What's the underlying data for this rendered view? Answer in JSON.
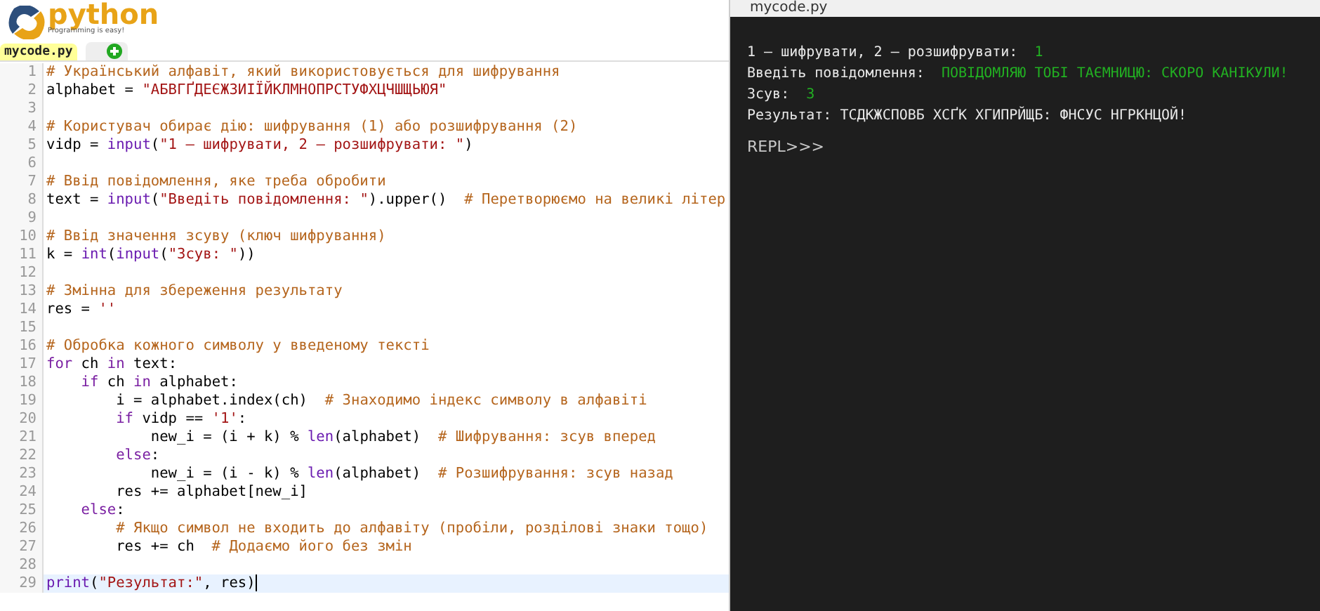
{
  "logo": {
    "name": "python",
    "tagline": "Programming is easy!"
  },
  "tabs": [
    {
      "label": "mycode.py",
      "selected": true
    }
  ],
  "code": [
    {
      "n": "1",
      "tokens": [
        {
          "t": "# Український алфавіт, який використовується для шифрування",
          "kind": "comment"
        }
      ]
    },
    {
      "n": "2",
      "tokens": [
        {
          "t": "alphabet = ",
          "kind": "plain"
        },
        {
          "t": "\"АБВГҐДЕЄЖЗИІЇЙКЛМНОПРСТУФХЦЧШЩЬЮЯ\"",
          "kind": "string"
        }
      ]
    },
    {
      "n": "3"
    },
    {
      "n": "4",
      "tokens": [
        {
          "t": "# Користувач обирає дію: шифрування (1) або розшифрування (2)",
          "kind": "comment"
        }
      ]
    },
    {
      "n": "5",
      "tokens": [
        {
          "t": "vidp = ",
          "kind": "plain"
        },
        {
          "t": "input",
          "kind": "builtin"
        },
        {
          "t": "(",
          "kind": "plain"
        },
        {
          "t": "\"1 — шифрувати, 2 — розшифрувати: \"",
          "kind": "string"
        },
        {
          "t": ")",
          "kind": "plain"
        }
      ]
    },
    {
      "n": "6"
    },
    {
      "n": "7",
      "tokens": [
        {
          "t": "# Ввід повідомлення, яке треба обробити",
          "kind": "comment"
        }
      ]
    },
    {
      "n": "8",
      "tokens": [
        {
          "t": "text = ",
          "kind": "plain"
        },
        {
          "t": "input",
          "kind": "builtin"
        },
        {
          "t": "(",
          "kind": "plain"
        },
        {
          "t": "\"Введіть повідомлення: \"",
          "kind": "string"
        },
        {
          "t": ").upper()  ",
          "kind": "plain"
        },
        {
          "t": "# Перетворюємо на великі літер",
          "kind": "comment"
        }
      ]
    },
    {
      "n": "9"
    },
    {
      "n": "10",
      "tokens": [
        {
          "t": "# Ввід значення зсуву (ключ шифрування)",
          "kind": "comment"
        }
      ]
    },
    {
      "n": "11",
      "tokens": [
        {
          "t": "k = ",
          "kind": "plain"
        },
        {
          "t": "int",
          "kind": "builtin"
        },
        {
          "t": "(",
          "kind": "plain"
        },
        {
          "t": "input",
          "kind": "builtin"
        },
        {
          "t": "(",
          "kind": "plain"
        },
        {
          "t": "\"Зсув: \"",
          "kind": "string"
        },
        {
          "t": "))",
          "kind": "plain"
        }
      ]
    },
    {
      "n": "12"
    },
    {
      "n": "13",
      "tokens": [
        {
          "t": "# Змінна для збереження результату",
          "kind": "comment"
        }
      ]
    },
    {
      "n": "14",
      "tokens": [
        {
          "t": "res = ",
          "kind": "plain"
        },
        {
          "t": "''",
          "kind": "string"
        }
      ]
    },
    {
      "n": "15"
    },
    {
      "n": "16",
      "tokens": [
        {
          "t": "# Обробка кожного символу у введеному тексті",
          "kind": "comment"
        }
      ]
    },
    {
      "n": "17",
      "tokens": [
        {
          "t": "for",
          "kind": "keyword"
        },
        {
          "t": " ch ",
          "kind": "plain"
        },
        {
          "t": "in",
          "kind": "keyword"
        },
        {
          "t": " text:",
          "kind": "plain"
        }
      ]
    },
    {
      "n": "18",
      "tokens": [
        {
          "t": "    if",
          "kind": "keyword"
        },
        {
          "t": " ch ",
          "kind": "plain"
        },
        {
          "t": "in",
          "kind": "keyword"
        },
        {
          "t": " alphabet:",
          "kind": "plain"
        }
      ]
    },
    {
      "n": "19",
      "tokens": [
        {
          "t": "        i = alphabet.index(ch)  ",
          "kind": "plain"
        },
        {
          "t": "# Знаходимо індекс символу в алфавіті",
          "kind": "comment"
        }
      ]
    },
    {
      "n": "20",
      "tokens": [
        {
          "t": "        if",
          "kind": "keyword"
        },
        {
          "t": " vidp == ",
          "kind": "plain"
        },
        {
          "t": "'1'",
          "kind": "string"
        },
        {
          "t": ":",
          "kind": "plain"
        }
      ]
    },
    {
      "n": "21",
      "tokens": [
        {
          "t": "            new_i = (i + k) % ",
          "kind": "plain"
        },
        {
          "t": "len",
          "kind": "builtin"
        },
        {
          "t": "(alphabet)  ",
          "kind": "plain"
        },
        {
          "t": "# Шифрування: зсув вперед",
          "kind": "comment"
        }
      ]
    },
    {
      "n": "22",
      "tokens": [
        {
          "t": "        else",
          "kind": "keyword"
        },
        {
          "t": ":",
          "kind": "plain"
        }
      ]
    },
    {
      "n": "23",
      "tokens": [
        {
          "t": "            new_i = (i - k) % ",
          "kind": "plain"
        },
        {
          "t": "len",
          "kind": "builtin"
        },
        {
          "t": "(alphabet)  ",
          "kind": "plain"
        },
        {
          "t": "# Розшифрування: зсув назад",
          "kind": "comment"
        }
      ]
    },
    {
      "n": "24",
      "tokens": [
        {
          "t": "        res += alphabet[new_i]",
          "kind": "plain"
        }
      ]
    },
    {
      "n": "25",
      "tokens": [
        {
          "t": "    else",
          "kind": "keyword"
        },
        {
          "t": ":",
          "kind": "plain"
        }
      ]
    },
    {
      "n": "26",
      "tokens": [
        {
          "t": "        # Якщо символ не входить до алфавіту (пробіли, розділові знаки тощо)",
          "kind": "comment"
        }
      ]
    },
    {
      "n": "27",
      "tokens": [
        {
          "t": "        res += ch  ",
          "kind": "plain"
        },
        {
          "t": "# Додаємо його без змін",
          "kind": "comment"
        }
      ]
    },
    {
      "n": "28"
    },
    {
      "n": "29",
      "current": true,
      "tokens": [
        {
          "t": "print",
          "kind": "builtin"
        },
        {
          "t": "(",
          "kind": "plain"
        },
        {
          "t": "\"Результат:\"",
          "kind": "string"
        },
        {
          "t": ", res)",
          "kind": "plain"
        }
      ]
    }
  ],
  "console": {
    "title": "mycode.py",
    "lines": [
      {
        "text": "1 — шифрувати, 2 — розшифрувати: ",
        "input": "1"
      },
      {
        "text": "Введіть повідомлення: ",
        "input": "ПОВІДОМЛЯЮ ТОБІ ТАЄМНИЦЮ: СКОРО КАНІКУЛИ!"
      },
      {
        "text": "Зсув: ",
        "input": "3"
      },
      {
        "text": "Результат: ТСДКЖСПОВБ ХСҐК ХГИПРЙЩБ: ФНСУС НГРКНЦОЙ!"
      }
    ],
    "prompt": "REPL>>>"
  }
}
